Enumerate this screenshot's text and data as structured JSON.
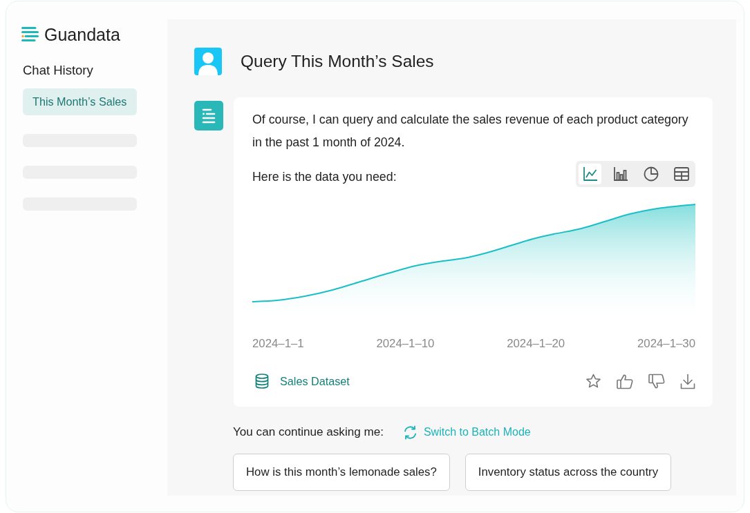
{
  "sidebar": {
    "brand": "Guandata",
    "section_title": "Chat History",
    "history": [
      {
        "kind": "entry",
        "label": "This Month’s Sales",
        "selected": true
      },
      {
        "kind": "skeleton",
        "selected": false
      },
      {
        "kind": "skeleton",
        "selected": false
      },
      {
        "kind": "skeleton",
        "selected": false
      }
    ]
  },
  "conversation": {
    "question": "Query This Month’s Sales",
    "answer": {
      "text": "Of course, I can query and calculate the sales revenue of each product category in the past 1 month of 2024.",
      "data_intro": "Here is the data you need:",
      "view_switcher": [
        {
          "kind": "line",
          "selected": true
        },
        {
          "kind": "bar",
          "selected": false
        },
        {
          "kind": "pie",
          "selected": false
        },
        {
          "kind": "table",
          "selected": false
        }
      ],
      "chart": {
        "kind": "area",
        "x_labels": [
          "2024–1–1",
          "2024–1–10",
          "2024–1–20",
          "2024–1–30"
        ]
      },
      "source": "Sales Dataset",
      "actions": [
        {
          "kind": "star"
        },
        {
          "kind": "thumbs-up"
        },
        {
          "kind": "thumbs-down"
        },
        {
          "kind": "download"
        }
      ]
    },
    "follow_up": {
      "prompt": "You can continue asking me:",
      "switch_link": "Switch to Batch Mode",
      "suggestions": [
        "How is this month’s lemonade sales?",
        "Inventory status across the country"
      ]
    }
  }
}
